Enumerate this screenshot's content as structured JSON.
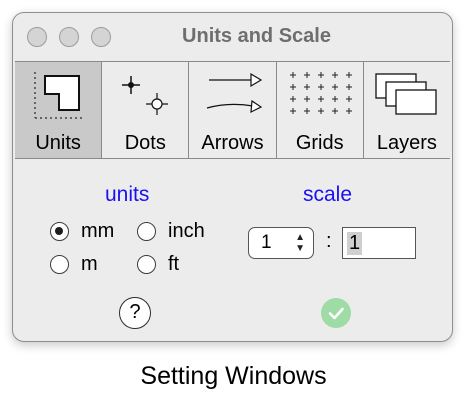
{
  "window": {
    "title": "Units and Scale"
  },
  "toolbar": {
    "items": [
      {
        "label": "Units",
        "icon": "units-icon",
        "active": true
      },
      {
        "label": "Dots",
        "icon": "dots-icon",
        "active": false
      },
      {
        "label": "Arrows",
        "icon": "arrows-icon",
        "active": false
      },
      {
        "label": "Grids",
        "icon": "grids-icon",
        "active": false
      },
      {
        "label": "Layers",
        "icon": "layers-icon",
        "active": false
      }
    ]
  },
  "units": {
    "heading": "units",
    "options": [
      {
        "label": "mm",
        "selected": true
      },
      {
        "label": "inch",
        "selected": false
      },
      {
        "label": "m",
        "selected": false
      },
      {
        "label": "ft",
        "selected": false
      }
    ]
  },
  "scale": {
    "heading": "scale",
    "left_value": "1",
    "separator": ":",
    "right_value": "1",
    "stepper_arrows": "up-down-chevron-icon"
  },
  "help_label": "?",
  "ok_icon": "checkmark-icon",
  "caption": "Setting Windows",
  "colors": {
    "heading": "#1a10f0",
    "active_tab": "#c9c9c9",
    "ok_button": "#9fdba5",
    "window_bg": "#ececec"
  }
}
